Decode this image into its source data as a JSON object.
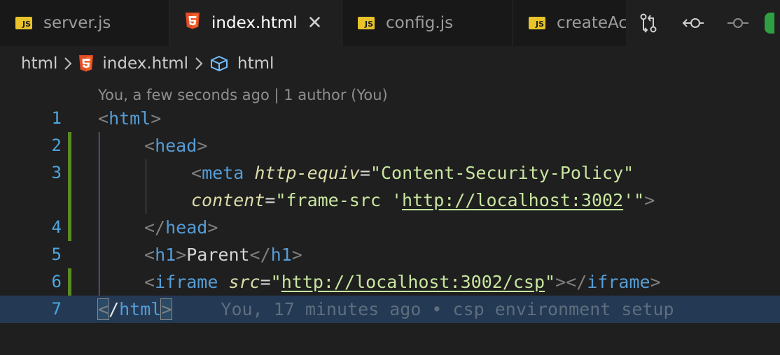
{
  "tabs": [
    {
      "label": "server.js",
      "icon": "js-icon",
      "active": false
    },
    {
      "label": "index.html",
      "icon": "html5-icon",
      "active": true,
      "close": "✕"
    },
    {
      "label": "config.js",
      "icon": "js-icon",
      "active": false
    },
    {
      "label": "createAc",
      "icon": "js-icon",
      "active": false
    }
  ],
  "js_badge": "JS",
  "actions": [
    "source-compare-icon",
    "go-back-commit-icon",
    "commit-node-icon"
  ],
  "breadcrumb": {
    "root": "html",
    "file": "index.html",
    "symbol": "html"
  },
  "codelens": "You, a few seconds ago | 1 author (You)",
  "line_numbers": [
    "1",
    "2",
    "3",
    "4",
    "5",
    "6",
    "7"
  ],
  "code": {
    "l1": {
      "open": "<",
      "tag": "html",
      "close": ">"
    },
    "l2": {
      "open": "<",
      "tag": "head",
      "close": ">"
    },
    "l3": {
      "open": "<",
      "tag": "meta",
      "attr": "http-equiv",
      "eq": "=",
      "val": "\"Content-Security-Policy\""
    },
    "l3b": {
      "attr": "content",
      "eq": "=",
      "q1": "\"frame-src '",
      "url": "http://localhost:3002",
      "q2": "'\"",
      "close": ">"
    },
    "l4": {
      "open": "</",
      "tag": "head",
      "close": ">"
    },
    "l5": {
      "open": "<",
      "tag": "h1",
      "close": ">",
      "text": "Parent",
      "open2": "</",
      "tag2": "h1",
      "close2": ">"
    },
    "l6": {
      "open": "<",
      "tag": "iframe",
      "attr": "src",
      "eq": "=",
      "q1": "\"",
      "url": "http://localhost:3002/csp",
      "q2": "\"",
      "close": ">",
      "open2": "</",
      "tag2": "iframe",
      "close2": ">"
    },
    "l7": {
      "open": "<",
      "slash": "/",
      "tag": "html",
      "close": ">"
    }
  },
  "blame": "You, 17 minutes ago • csp environment setup",
  "colors": {
    "tag": "#569cd6",
    "attr": "#dcdcaa",
    "string": "#ce9178",
    "line_number": "#4fa6e0",
    "modified_gutter": "#5a8a23",
    "current_line": "#233954"
  }
}
